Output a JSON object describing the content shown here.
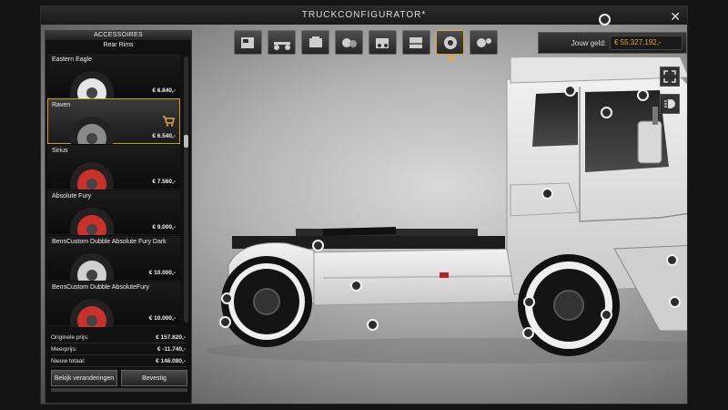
{
  "window": {
    "title": "TRUCKCONFIGURATOR*",
    "close_icon": "close-icon"
  },
  "toolbar": {
    "buttons": [
      {
        "name": "cabin-icon"
      },
      {
        "name": "chassis-icon"
      },
      {
        "name": "engine-icon"
      },
      {
        "name": "transmission-icon"
      },
      {
        "name": "lights-icon"
      },
      {
        "name": "paint-icon"
      },
      {
        "name": "wheels-icon",
        "active": true
      },
      {
        "name": "interior-icon"
      }
    ]
  },
  "money": {
    "label": "Jouw geld:",
    "value": "€ 55.327.192,-"
  },
  "panel": {
    "header": "ACCESSOIRES",
    "subheader": "Rear Rims",
    "items": [
      {
        "name": "Eastern Eagle",
        "price": "€ 6.840,-"
      },
      {
        "name": "Raven",
        "price": "€ 6.540,-",
        "selected": true
      },
      {
        "name": "Sirius",
        "price": "€ 7.560,-"
      },
      {
        "name": "Absolute Fury",
        "price": "€ 9.000,-"
      },
      {
        "name": "BensCustom Dubble Absolute Fury Dark",
        "price": "€ 10.000,-"
      },
      {
        "name": "BensCustom Dubble AbsoluteFury",
        "price": "€ 10.000,-"
      }
    ],
    "totals": {
      "original_label": "Originele prijs:",
      "original_value": "€ 157.820,-",
      "extra_label": "Meerprijs:",
      "extra_value": "€ -11.740,-",
      "new_label": "Nieuw totaal:",
      "new_value": "€ 146.080,-"
    },
    "review_button": "Bekijk veranderingen",
    "confirm_button": "Bevestig"
  },
  "colors": {
    "accent": "#e8a83b",
    "selected_border": "#c79a2a"
  }
}
